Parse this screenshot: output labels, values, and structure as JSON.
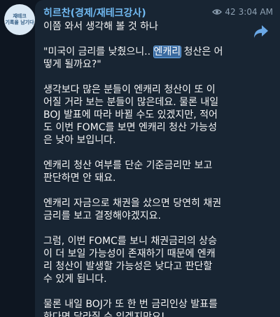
{
  "avatar": {
    "line1": "재테크",
    "line2": "기록을 남기다"
  },
  "message": {
    "sender": "히르찬(경제/재테크강사)",
    "views": "42",
    "time": "3:04 AM",
    "intro": "이쯤 와서 생각해 볼 것 하나",
    "quote_before": "\"미국이 금리를 낮췄으니.. ",
    "quote_highlight": "엔캐리",
    "quote_after": " 청산은 어\n떻게 될까요?\"",
    "p1": "생각보다 많은 분들이 엔캐리 청산이 또 이\n어질 거라 보는 분들이 많은데요. 물론 내일\nBOJ 발표에 따라 바뀔 수도 있겠지만, 적어\n도 이번 FOMC를 보면 엔캐리 청산 가능성\n은 낮아 보입니다.",
    "p2": "엔캐리 청산 여부를 단순 기준금리만 보고\n판단하면 안 돼요.",
    "p3": "엔캐리 자금으로 채권을 샀으면 당연히 채권\n금리를 보고 결정해야겠지요.",
    "p4": "그럼, 이번 FOMC를 보니 채권금리의 상승\n이 더 보일 가능성이 존재하기 때문에 엔캐\n리 청산이 발생할 가능성은 낮다고 판단할\n수 있게 됩니다.",
    "p5": "물론 내일 BOJ가 또 한 번 금리인상 발표를\n한다면 달라질 수 있겠지만요!"
  },
  "colors": {
    "background": "#0e1621",
    "bubble": "#182533",
    "sender": "#71baf2",
    "highlight": "#3a6aa0"
  },
  "icons": {
    "views": "eye-icon",
    "share": "share-arrow-icon"
  }
}
